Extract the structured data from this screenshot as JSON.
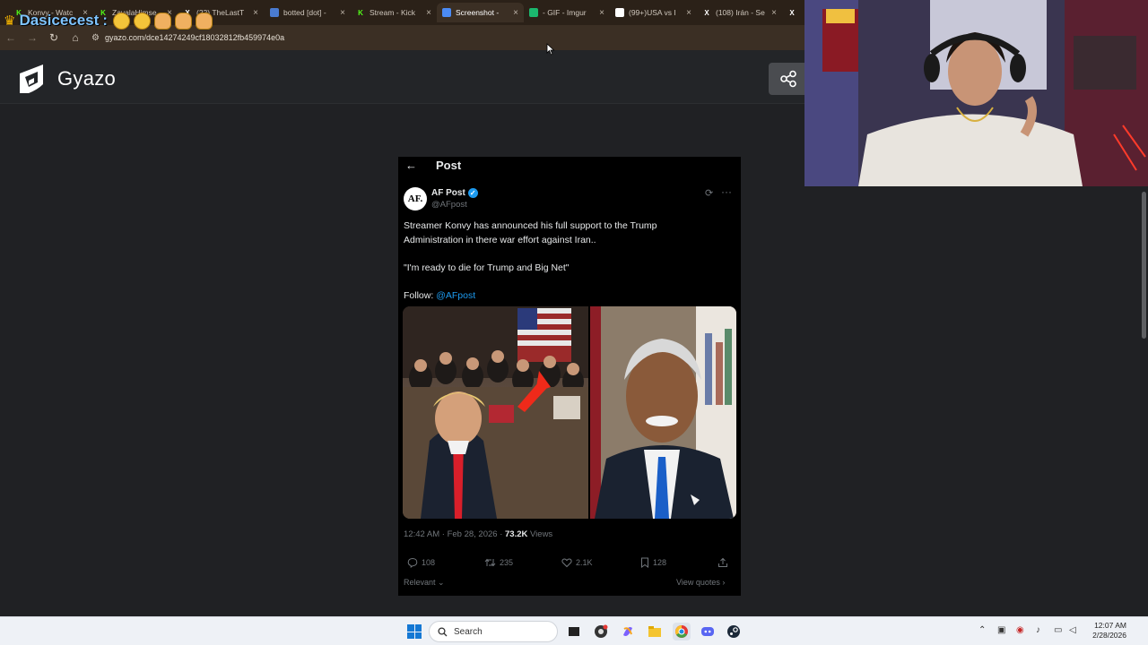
{
  "browser": {
    "tabs": [
      {
        "title": "Konvy - Watc",
        "fav": "K",
        "fav_color": "#53fc18",
        "active": false
      },
      {
        "title": "ZavalaHimse",
        "fav": "K",
        "fav_color": "#53fc18",
        "active": false
      },
      {
        "title": "(22) TheLastT",
        "fav": "X",
        "fav_color": "#ffffff",
        "active": false
      },
      {
        "title": "botted [dot] -",
        "fav": "",
        "fav_color": "#4a7bd0",
        "active": false
      },
      {
        "title": "Stream - Kick",
        "fav": "K",
        "fav_color": "#53fc18",
        "active": false
      },
      {
        "title": "Screenshot -",
        "fav": "",
        "fav_color": "#4b8bf5",
        "active": true
      },
      {
        "title": "- GIF - Imgur",
        "fav": "",
        "fav_color": "#1bb76e",
        "active": false
      },
      {
        "title": "(99+)USA vs I",
        "fav": "",
        "fav_color": "#ffffff",
        "active": false
      },
      {
        "title": "(108) Irán - Se",
        "fav": "X",
        "fav_color": "#ffffff",
        "active": false
      },
      {
        "title": "",
        "fav": "X",
        "fav_color": "#ffffff",
        "active": false
      }
    ],
    "url": "gyazo.com/dce14274249cf18032812fb459974e0a"
  },
  "stream_overlay": {
    "username": "Dasicecest",
    "separator": ":"
  },
  "gyazo": {
    "brand": "Gyazo",
    "share_icon": "share-icon"
  },
  "tweet": {
    "header_title": "Post",
    "author_name": "AF Post",
    "author_handle": "@AFpost",
    "avatar_text": "AF.",
    "body_lines": [
      "Streamer Konvy has announced his full support to the Trump",
      "Administration in there war effort against Iran..",
      "",
      "\"I'm ready to die for Trump and Big Net\"",
      ""
    ],
    "follow_label": "Follow:",
    "follow_link": "@AFpost",
    "timestamp": "12:42 AM · Feb 28, 2026 · ",
    "views_count": "73.2K",
    "views_label": " Views",
    "replies": "108",
    "reposts": "235",
    "likes": "2.1K",
    "bookmarks": "128",
    "relevant_label": "Relevant",
    "view_quotes_label": "View quotes"
  },
  "taskbar": {
    "search_placeholder": "Search",
    "clock_time": "12:07 AM",
    "clock_date": "2/28/2026"
  },
  "colors": {
    "tab_strip": "#2b2118",
    "gyazo_header": "#232528",
    "tweet_bg": "#000000",
    "link_blue": "#1d9bf0",
    "windows_blue": "#1478d4"
  }
}
